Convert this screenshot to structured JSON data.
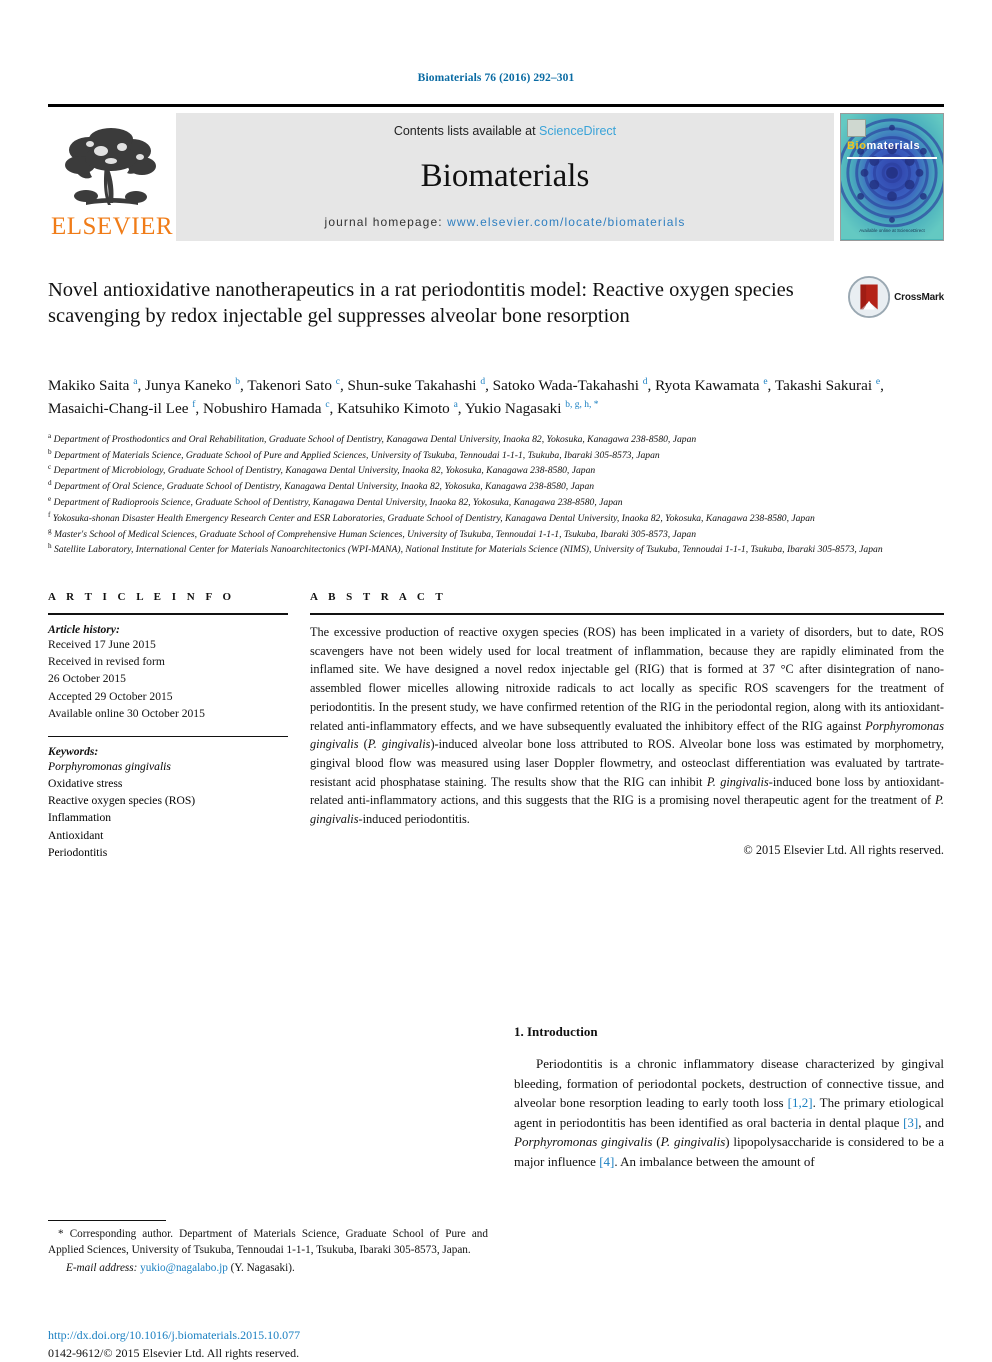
{
  "running_head": "Biomaterials 76 (2016) 292–301",
  "masthead": {
    "contents_prefix": "Contents lists available at ",
    "sciencedirect": "ScienceDirect",
    "journal_title": "Biomaterials",
    "homepage_prefix": "journal homepage: ",
    "homepage_url": "www.elsevier.com/locate/biomaterials",
    "publisher_wordmark": "ELSEVIER",
    "cover": {
      "label_b": "Bio",
      "label_rest": "materials",
      "foot_line": "Available online at\nScienceDirect"
    }
  },
  "title": "Novel antioxidative nanotherapeutics in a rat periodontitis model: Reactive oxygen species scavenging by redox injectable gel suppresses alveolar bone resorption",
  "crossmark_label": "CrossMark",
  "authors_html": "Makiko Saita <sup>a</sup>, Junya Kaneko <sup>b</sup>, Takenori Sato <sup>c</sup>, Shun-suke Takahashi <sup>d</sup>, Satoko Wada-Takahashi <sup>d</sup>, Ryota Kawamata <sup>e</sup>, Takashi Sakurai <sup>e</sup>, Masaichi-Chang-il Lee <sup>f</sup>, Nobushiro Hamada <sup>c</sup>, Katsuhiko Kimoto <sup>a</sup>, Yukio Nagasaki <sup>b, g, h, *</sup>",
  "affiliations": [
    {
      "marker": "a",
      "text": "Department of Prosthodontics and Oral Rehabilitation, Graduate School of Dentistry, Kanagawa Dental University, Inaoka 82, Yokosuka, Kanagawa 238-8580, Japan"
    },
    {
      "marker": "b",
      "text": "Department of Materials Science, Graduate School of Pure and Applied Sciences, University of Tsukuba, Tennoudai 1-1-1, Tsukuba, Ibaraki 305-8573, Japan"
    },
    {
      "marker": "c",
      "text": "Department of Microbiology, Graduate School of Dentistry, Kanagawa Dental University, Inaoka 82, Yokosuka, Kanagawa 238-8580, Japan"
    },
    {
      "marker": "d",
      "text": "Department of Oral Science, Graduate School of Dentistry, Kanagawa Dental University, Inaoka 82, Yokosuka, Kanagawa 238-8580, Japan"
    },
    {
      "marker": "e",
      "text": "Department of Radioproois Science, Graduate School of Dentistry, Kanagawa Dental University, Inaoka 82, Yokosuka, Kanagawa 238-8580, Japan"
    },
    {
      "marker": "f",
      "text": "Yokosuka-shonan Disaster Health Emergency Research Center and ESR Laboratories, Graduate School of Dentistry, Kanagawa Dental University, Inaoka 82, Yokosuka, Kanagawa 238-8580, Japan"
    },
    {
      "marker": "g",
      "text": "Master's School of Medical Sciences, Graduate School of Comprehensive Human Sciences, University of Tsukuba, Tennoudai 1-1-1, Tsukuba, Ibaraki 305-8573, Japan"
    },
    {
      "marker": "h",
      "text": "Satellite Laboratory, International Center for Materials Nanoarchitectonics (WPI-MANA), National Institute for Materials Science (NIMS), University of Tsukuba, Tennoudai 1-1-1, Tsukuba, Ibaraki 305-8573, Japan"
    }
  ],
  "article_info": {
    "heading": "A R T I C L E   I N F O",
    "history_label": "Article history:",
    "history": [
      "Received 17 June 2015",
      "Received in revised form",
      "26 October 2015",
      "Accepted 29 October 2015",
      "Available online 30 October 2015"
    ],
    "keywords_label": "Keywords:",
    "keywords": [
      {
        "text": "Porphyromonas gingivalis",
        "italic": true
      },
      {
        "text": "Oxidative stress",
        "italic": false
      },
      {
        "text": "Reactive oxygen species (ROS)",
        "italic": false
      },
      {
        "text": "Inflammation",
        "italic": false
      },
      {
        "text": "Antioxidant",
        "italic": false
      },
      {
        "text": "Periodontitis",
        "italic": false
      }
    ]
  },
  "abstract": {
    "heading": "A B S T R A C T",
    "body_html": "The excessive production of reactive oxygen species (ROS) has been implicated in a variety of disorders, but to date, ROS scavengers have not been widely used for local treatment of inflammation, because they are rapidly eliminated from the inflamed site. We have designed a novel redox injectable gel (RIG) that is formed at 37 &deg;C after disintegration of nano-assembled flower micelles allowing nitroxide radicals to act locally as specific ROS scavengers for the treatment of periodontitis. In the present study, we have confirmed retention of the RIG in the periodontal region, along with its antioxidant-related anti-inflammatory effects, and we have subsequently evaluated the inhibitory effect of the RIG against <i>Porphyromonas gingivalis</i> (<i>P. gingivalis</i>)-induced alveolar bone loss attributed to ROS. Alveolar bone loss was estimated by morphometry, gingival blood flow was measured using laser Doppler flowmetry, and osteoclast differentiation was evaluated by tartrate-resistant acid phosphatase staining. The results show that the RIG can inhibit <i>P. gingivalis</i>-induced bone loss by antioxidant-related anti-inflammatory actions, and this suggests that the RIG is a promising novel therapeutic agent for the treatment of <i>P. gingivalis</i>-induced periodontitis.",
    "copyright": "© 2015 Elsevier Ltd. All rights reserved."
  },
  "introduction": {
    "heading": "1.  Introduction",
    "body_html": "Periodontitis is a chronic inflammatory disease characterized by gingival bleeding, formation of periodontal pockets, destruction of connective tissue, and alveolar bone resorption leading to early tooth loss <span class=\"ref\">[1,2]</span>. The primary etiological agent in periodontitis has been identified as oral bacteria in dental plaque <span class=\"ref\">[3]</span>, and <i>Porphyromonas gingivalis</i> (<i>P. gingivalis</i>) lipopolysaccharide is considered to be a major influence <span class=\"ref\">[4]</span>. An imbalance between the amount of"
  },
  "footnote": {
    "corresponding_html": "* Corresponding author. Department of Materials Science, Graduate School of Pure and Applied Sciences, University of Tsukuba, Tennoudai 1-1-1, Tsukuba, Ibaraki 305-8573, Japan.",
    "email_label": "E-mail address:",
    "email": "yukio@nagalabo.jp",
    "email_suffix": "(Y. Nagasaki)."
  },
  "doi": {
    "url": "http://dx.doi.org/10.1016/j.biomaterials.2015.10.077",
    "issn_line": "0142-9612/© 2015 Elsevier Ltd. All rights reserved."
  },
  "colors": {
    "link_blue": "#1a7fc1",
    "header_blue": "#0a6ba3",
    "sciencedirect_blue": "#3aa3d8",
    "elsevier_orange": "#F07C18",
    "band_gray": "#e6e6e6"
  }
}
